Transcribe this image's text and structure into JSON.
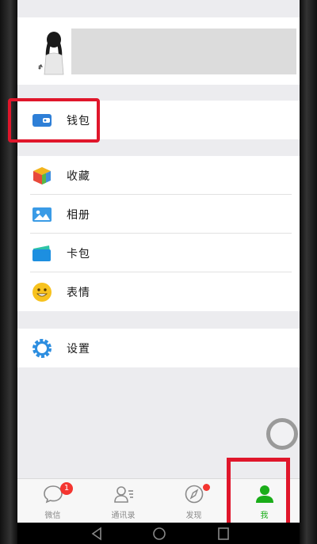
{
  "menu": {
    "wallet": {
      "label": "钱包",
      "icon": "wallet-icon"
    },
    "favorites": {
      "label": "收藏",
      "icon": "favorites-cube-icon"
    },
    "album": {
      "label": "相册",
      "icon": "album-image-icon"
    },
    "cards": {
      "label": "卡包",
      "icon": "card-wallet-icon"
    },
    "stickers": {
      "label": "表情",
      "icon": "smiley-icon"
    },
    "settings": {
      "label": "设置",
      "icon": "gear-icon"
    }
  },
  "tabbar": {
    "chats": {
      "label": "微信",
      "badge": "1"
    },
    "contacts": {
      "label": "通讯录"
    },
    "discover": {
      "label": "发现"
    },
    "me": {
      "label": "我"
    }
  },
  "colors": {
    "accent_green": "#1aad19",
    "highlight_red": "#e0162b",
    "badge_red": "#f43530"
  }
}
